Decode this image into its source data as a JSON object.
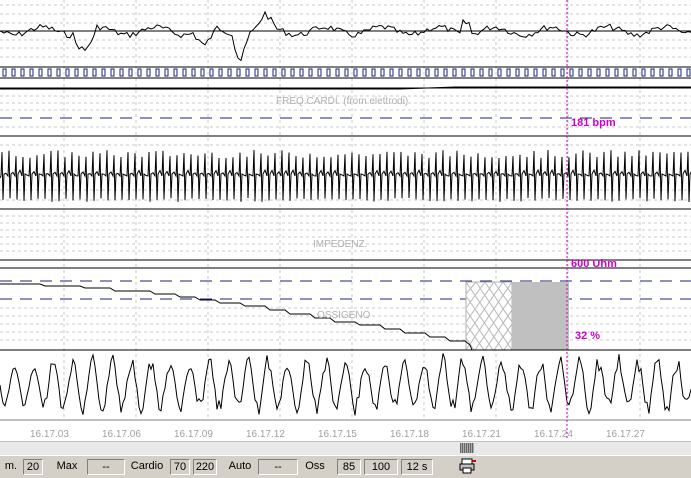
{
  "channels": {
    "heart_rate_label": "FREQ.CARDI. (from elettrodi)",
    "heart_rate_value": "181 bpm",
    "impedance_label": "IMPEDENZ.",
    "impedance_value": "600 Uhm",
    "oxygen_label": "OSSIGENO",
    "oxygen_value": "32 %"
  },
  "time_axis": [
    "16.17.03",
    "16.17.06",
    "16.17.09",
    "16.17.12",
    "16.17.15",
    "16.17.18",
    "16.17.21",
    "16.17.24",
    "16.17.27"
  ],
  "status": {
    "cells": [
      "m.",
      "20",
      "Max",
      "--",
      "Cardio",
      "70",
      "220",
      "Auto",
      "--",
      "Oss",
      "85",
      "100",
      "12 s"
    ]
  },
  "colors": {
    "trace": "#000000",
    "marker": "#cc00cc",
    "dashed_guide": "#1a237e",
    "grid": "#c8c8c8",
    "shade": "#c0c0c0"
  },
  "icons": [
    "printer-icon"
  ]
}
